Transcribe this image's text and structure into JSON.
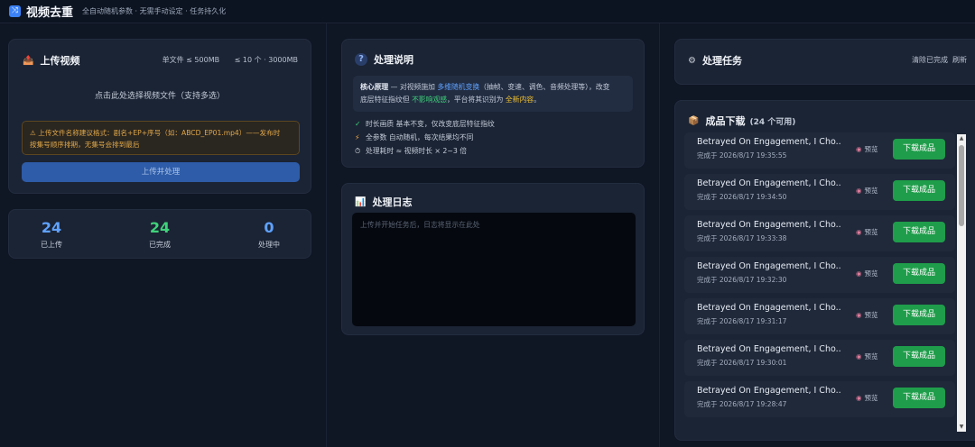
{
  "header": {
    "logo_icon": "⤨",
    "title": "视频去重",
    "subtitle": "全自动随机参数 · 无需手动设定 · 任务持久化"
  },
  "upload": {
    "title": "上传视频",
    "limit_single": "单文件 ≤ 500MB",
    "limit_total": "≤ 10 个 · 3000MB",
    "pick_text": "点击此处选择视频文件（支持多选）",
    "warning_line1": "上传文件名称建议格式：剧名+EP+序号（如：ABCD_EP01.mp4）——发布时",
    "warning_line2": "按集号顺序排期，无集号会排到最后",
    "button": "上传并处理"
  },
  "stats": {
    "uploaded": "24",
    "uploaded_label": "已上传",
    "completed": "24",
    "completed_label": "已完成",
    "processing": "0",
    "processing_label": "处理中"
  },
  "info": {
    "title": "处理说明",
    "core_label": "核心原理",
    "core_1": " — 对视频施加 ",
    "core_hl1": "多维随机变换",
    "core_2": "（抽帧、变速、调色、音频处理等），改变",
    "core_3": "底层特征指纹但 ",
    "core_hl2": "不影响观感",
    "core_4": "，平台将其识别为 ",
    "core_hl3": "全新内容",
    "core_5": "。",
    "bullets": [
      {
        "icon": "✓",
        "text": "时长画质 基本不变，仅改变底层特征指纹"
      },
      {
        "icon": "⚡",
        "text": "全参数 自动随机，每次结果均不同"
      },
      {
        "icon": "⏱",
        "text": "处理耗时 ≈ 视频时长 × 2~3 倍"
      }
    ]
  },
  "log": {
    "title": "处理日志",
    "placeholder": "上传并开始任务后，日志将显示在此处"
  },
  "tasks": {
    "title": "处理任务",
    "clear_label": "清除已完成",
    "refresh_label": "刷新"
  },
  "downloads": {
    "title": "成品下载",
    "count": "(24 个可用)",
    "preview_label": "预览",
    "button_label": "下载成品",
    "items": [
      {
        "name": "Betrayed On Engagement, I Cho...",
        "time": "完成于 2026/8/17 19:35:55"
      },
      {
        "name": "Betrayed On Engagement, I Cho...",
        "time": "完成于 2026/8/17 19:34:50"
      },
      {
        "name": "Betrayed On Engagement, I Cho...",
        "time": "完成于 2026/8/17 19:33:38"
      },
      {
        "name": "Betrayed On Engagement, I Cho...",
        "time": "完成于 2026/8/17 19:32:30"
      },
      {
        "name": "Betrayed On Engagement, I Cho...",
        "time": "完成于 2026/8/17 19:31:17"
      },
      {
        "name": "Betrayed On Engagement, I Cho...",
        "time": "完成于 2026/8/17 19:30:01"
      },
      {
        "name": "Betrayed On Engagement, I Cho...",
        "time": "完成于 2026/8/17 19:28:47"
      }
    ]
  },
  "colors": {
    "accent_blue": "#5fa2ff",
    "accent_green": "#3fd27a",
    "download_button": "#1f9d4a",
    "upload_button": "#2e5ca8",
    "warning_text": "#e0a84a"
  }
}
